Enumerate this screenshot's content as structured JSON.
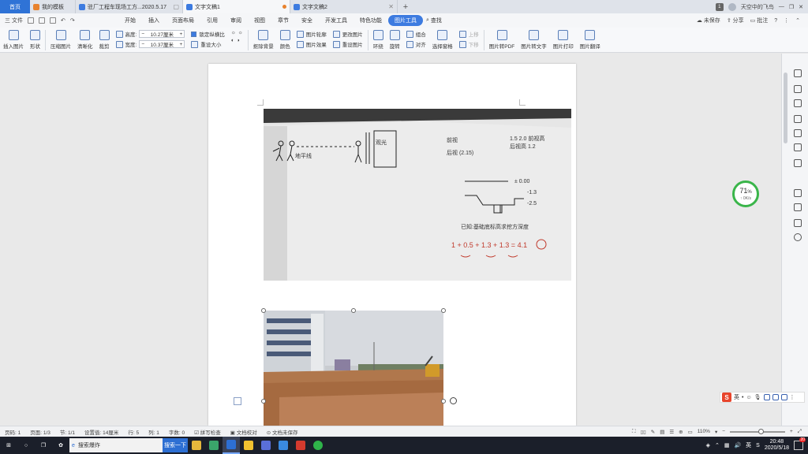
{
  "tabs": {
    "home": "首页",
    "t1": "我的模板",
    "t2": "驻厂工程车现场工方...2020.5.17",
    "t3": "文字文稿1",
    "t4": "文字文稿2",
    "plus": "+"
  },
  "tabbar_right": {
    "user": "天空中的飞鸟",
    "badge": "1"
  },
  "menu": {
    "file": "三 文件",
    "items": [
      "开始",
      "插入",
      "页面布局",
      "引用",
      "审阅",
      "视图",
      "章节",
      "安全",
      "开发工具",
      "特色功能",
      "图片工具"
    ],
    "active": "图片工具",
    "search": "查找",
    "unsaved": "未保存",
    "share": "分享",
    "annotate": "批注"
  },
  "ribbon": {
    "insert_picture": "插入图片",
    "shape": "形状",
    "compress": "压缩图片",
    "clarity": "清晰化",
    "crop": "裁剪",
    "height_label": "高度:",
    "height_value": "10.27厘米",
    "width_label": "宽度:",
    "width_value": "10.37厘米",
    "lock_ratio": "锁定纵横比",
    "reset_size": "重设大小",
    "cutout": "抠除背景",
    "color": "颜色",
    "set_transparent": "设置透明色",
    "picture_outline": "图片轮廓",
    "picture_effect": "图片效果",
    "change_picture": "更改图片",
    "reset_picture": "重设图片",
    "wrap": "环绕",
    "rotate": "旋转",
    "group": "组合",
    "align": "对齐",
    "select_pane": "选择窗格",
    "up": "上移",
    "down": "下移",
    "to_pdf": "图片转PDF",
    "to_text": "图片转文字",
    "print": "图片打印",
    "translate": "图片翻译"
  },
  "progress": {
    "percent": "71",
    "unit": "%",
    "speed": "↑ 0K/s"
  },
  "ime": {
    "logo": "S",
    "mode": "英"
  },
  "status": {
    "pages_label": "页码: 1",
    "page_of": "页面: 1/3",
    "section": "节: 1/1",
    "set_value": "设置值: 14厘米",
    "row": "行: 5",
    "col": "列: 1",
    "words": "字数: 0",
    "spell": "拼写检查",
    "doc_check": "文档校对",
    "unsaved_doc": "文档未保存",
    "zoom": "110%"
  },
  "taskbar": {
    "search_text": "搜索爆炸",
    "search_button": "搜索一下",
    "time": "20:48",
    "date": "2020/5/18",
    "notif_count": "20"
  },
  "colors": {
    "accent": "#3d7be0",
    "progress": "#3ab54a",
    "home_tab": "#2f73d6"
  }
}
